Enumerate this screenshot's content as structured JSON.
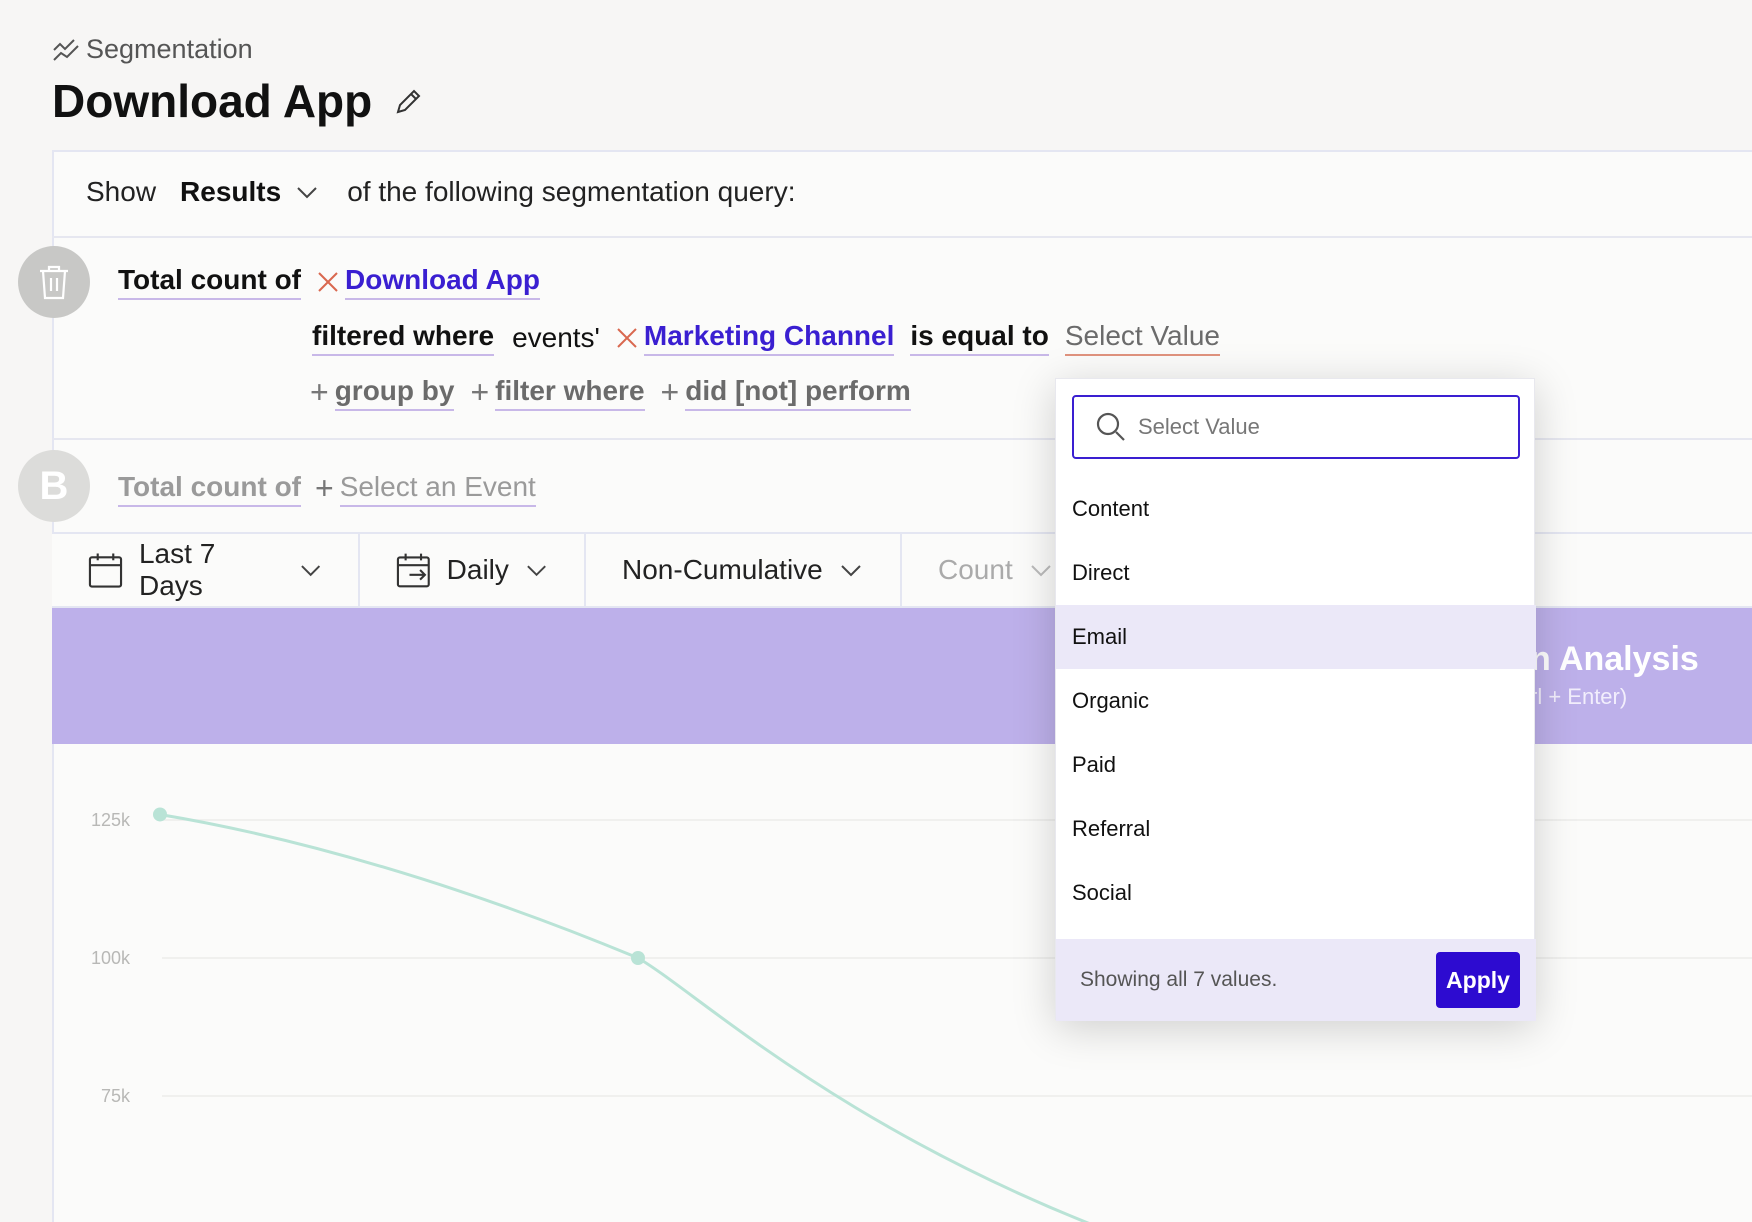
{
  "header": {
    "breadcrumb": "Segmentation",
    "title": "Download App"
  },
  "query": {
    "show_label": "Show",
    "show_value": "Results",
    "show_suffix": "of the following segmentation query:",
    "a": {
      "measure": "Total count of",
      "event": "Download App",
      "filter_label": "filtered where",
      "scope": "events'",
      "property": "Marketing Channel",
      "operator": "is equal to",
      "value_placeholder": "Select Value",
      "add_group_by": "group by",
      "add_filter_where": "filter where",
      "add_did_not_perform": "did [not] perform"
    },
    "b": {
      "letter": "B",
      "measure": "Total count of",
      "event_placeholder": "Select an Event"
    }
  },
  "toolbar": {
    "date_range": "Last 7 Days",
    "interval": "Daily",
    "cumulative": "Non-Cumulative",
    "metric": "Count"
  },
  "banner": {
    "title": "n Analysis",
    "subtitle": "rl + Enter)"
  },
  "chart_data": {
    "type": "line",
    "y_ticks": [
      "125k",
      "100k",
      "75k"
    ],
    "ylim": [
      50000,
      125000
    ],
    "points": [
      {
        "x": 0,
        "y": 126000
      },
      {
        "x": 1,
        "y": 100000
      },
      {
        "x": 2,
        "y": 50000
      }
    ],
    "color": "#b9e3d6",
    "grid": true
  },
  "dropdown": {
    "search_placeholder": "Select Value",
    "options": [
      "Content",
      "Direct",
      "Email",
      "Organic",
      "Paid",
      "Referral",
      "Social"
    ],
    "highlighted": "Email",
    "footer_text": "Showing all 7 values.",
    "apply_label": "Apply"
  },
  "colors": {
    "accent": "#3a1fd1",
    "banner": "#bdb0ea",
    "highlight": "#ebe8f8",
    "line": "#b9e3d6"
  }
}
